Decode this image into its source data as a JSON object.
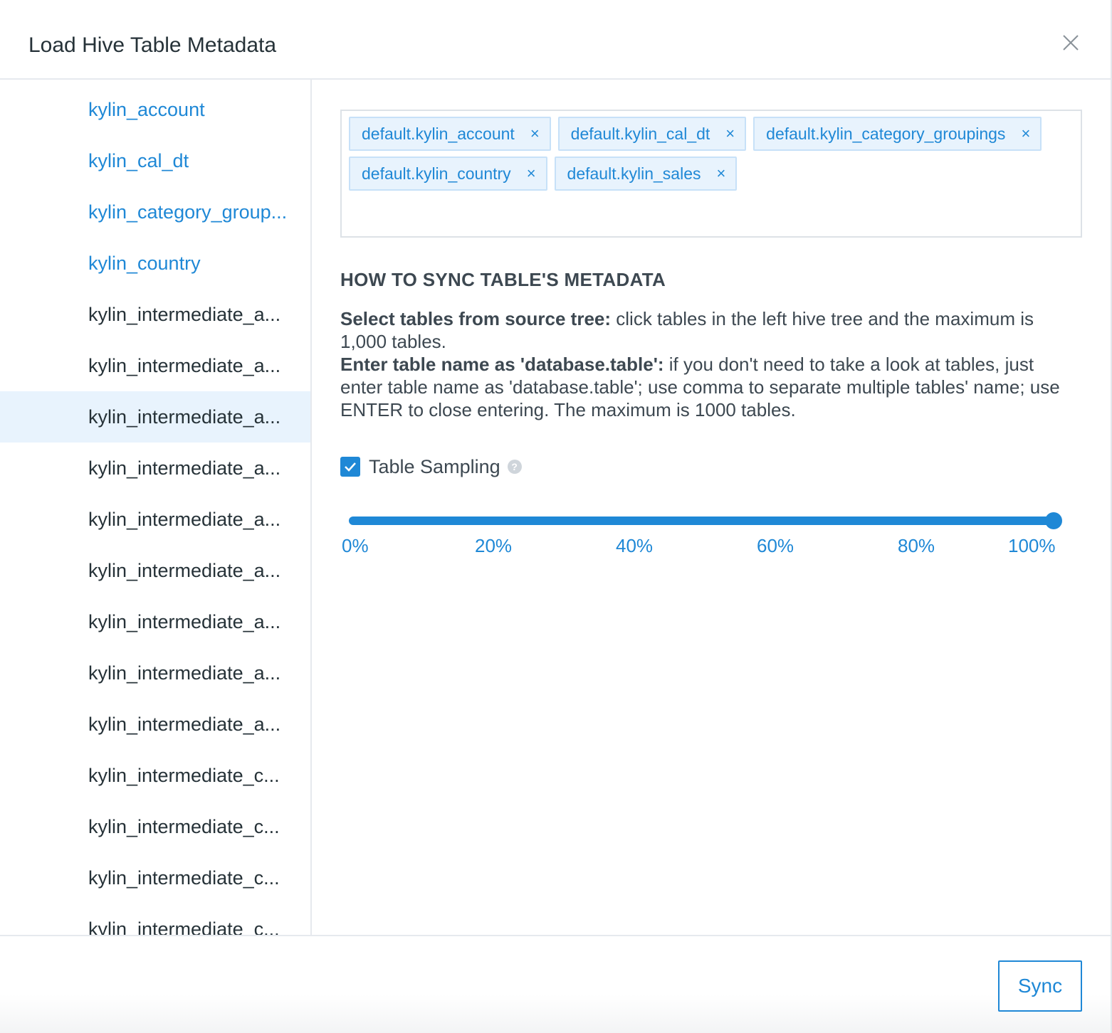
{
  "dialog": {
    "title": "Load Hive Table Metadata"
  },
  "sidebar": {
    "items": [
      {
        "label": "kylin_account",
        "state": "selected"
      },
      {
        "label": "kylin_cal_dt",
        "state": "selected"
      },
      {
        "label": "kylin_category_group...",
        "state": "selected"
      },
      {
        "label": "kylin_country",
        "state": "selected"
      },
      {
        "label": "kylin_intermediate_a...",
        "state": "normal"
      },
      {
        "label": "kylin_intermediate_a...",
        "state": "normal"
      },
      {
        "label": "kylin_intermediate_a...",
        "state": "hover"
      },
      {
        "label": "kylin_intermediate_a...",
        "state": "normal"
      },
      {
        "label": "kylin_intermediate_a...",
        "state": "normal"
      },
      {
        "label": "kylin_intermediate_a...",
        "state": "normal"
      },
      {
        "label": "kylin_intermediate_a...",
        "state": "normal"
      },
      {
        "label": "kylin_intermediate_a...",
        "state": "normal"
      },
      {
        "label": "kylin_intermediate_a...",
        "state": "normal"
      },
      {
        "label": "kylin_intermediate_c...",
        "state": "normal"
      },
      {
        "label": "kylin_intermediate_c...",
        "state": "normal"
      },
      {
        "label": "kylin_intermediate_c...",
        "state": "normal"
      },
      {
        "label": "kylin_intermediate_c...",
        "state": "normal"
      }
    ]
  },
  "tags": [
    {
      "label": "default.kylin_account",
      "remove": "×"
    },
    {
      "label": "default.kylin_cal_dt",
      "remove": "×"
    },
    {
      "label": "default.kylin_category_groupings",
      "remove": "×"
    },
    {
      "label": "default.kylin_country",
      "remove": "×"
    },
    {
      "label": "default.kylin_sales",
      "remove": "×"
    }
  ],
  "help": {
    "title": "HOW TO SYNC TABLE'S METADATA",
    "p1_bold": "Select tables from source tree:",
    "p1_text": " click tables in the left hive tree and the maximum is 1,000 tables.",
    "p2_bold": "Enter table name as 'database.table':",
    "p2_text": " if you don't need to take a look at tables, just enter table name as 'database.table'; use comma to separate multiple tables' name; use ENTER to close entering. The maximum is 1000 tables."
  },
  "sampling": {
    "label": "Table Sampling",
    "checked": true,
    "help_icon": "question-icon",
    "help_glyph": "?",
    "value_percent": 100,
    "marks": [
      "0%",
      "20%",
      "40%",
      "60%",
      "80%",
      "100%"
    ]
  },
  "footer": {
    "sync_label": "Sync"
  },
  "colors": {
    "accent": "#1f88d6",
    "text": "#263238",
    "hover_bg": "#e8f3fd"
  }
}
